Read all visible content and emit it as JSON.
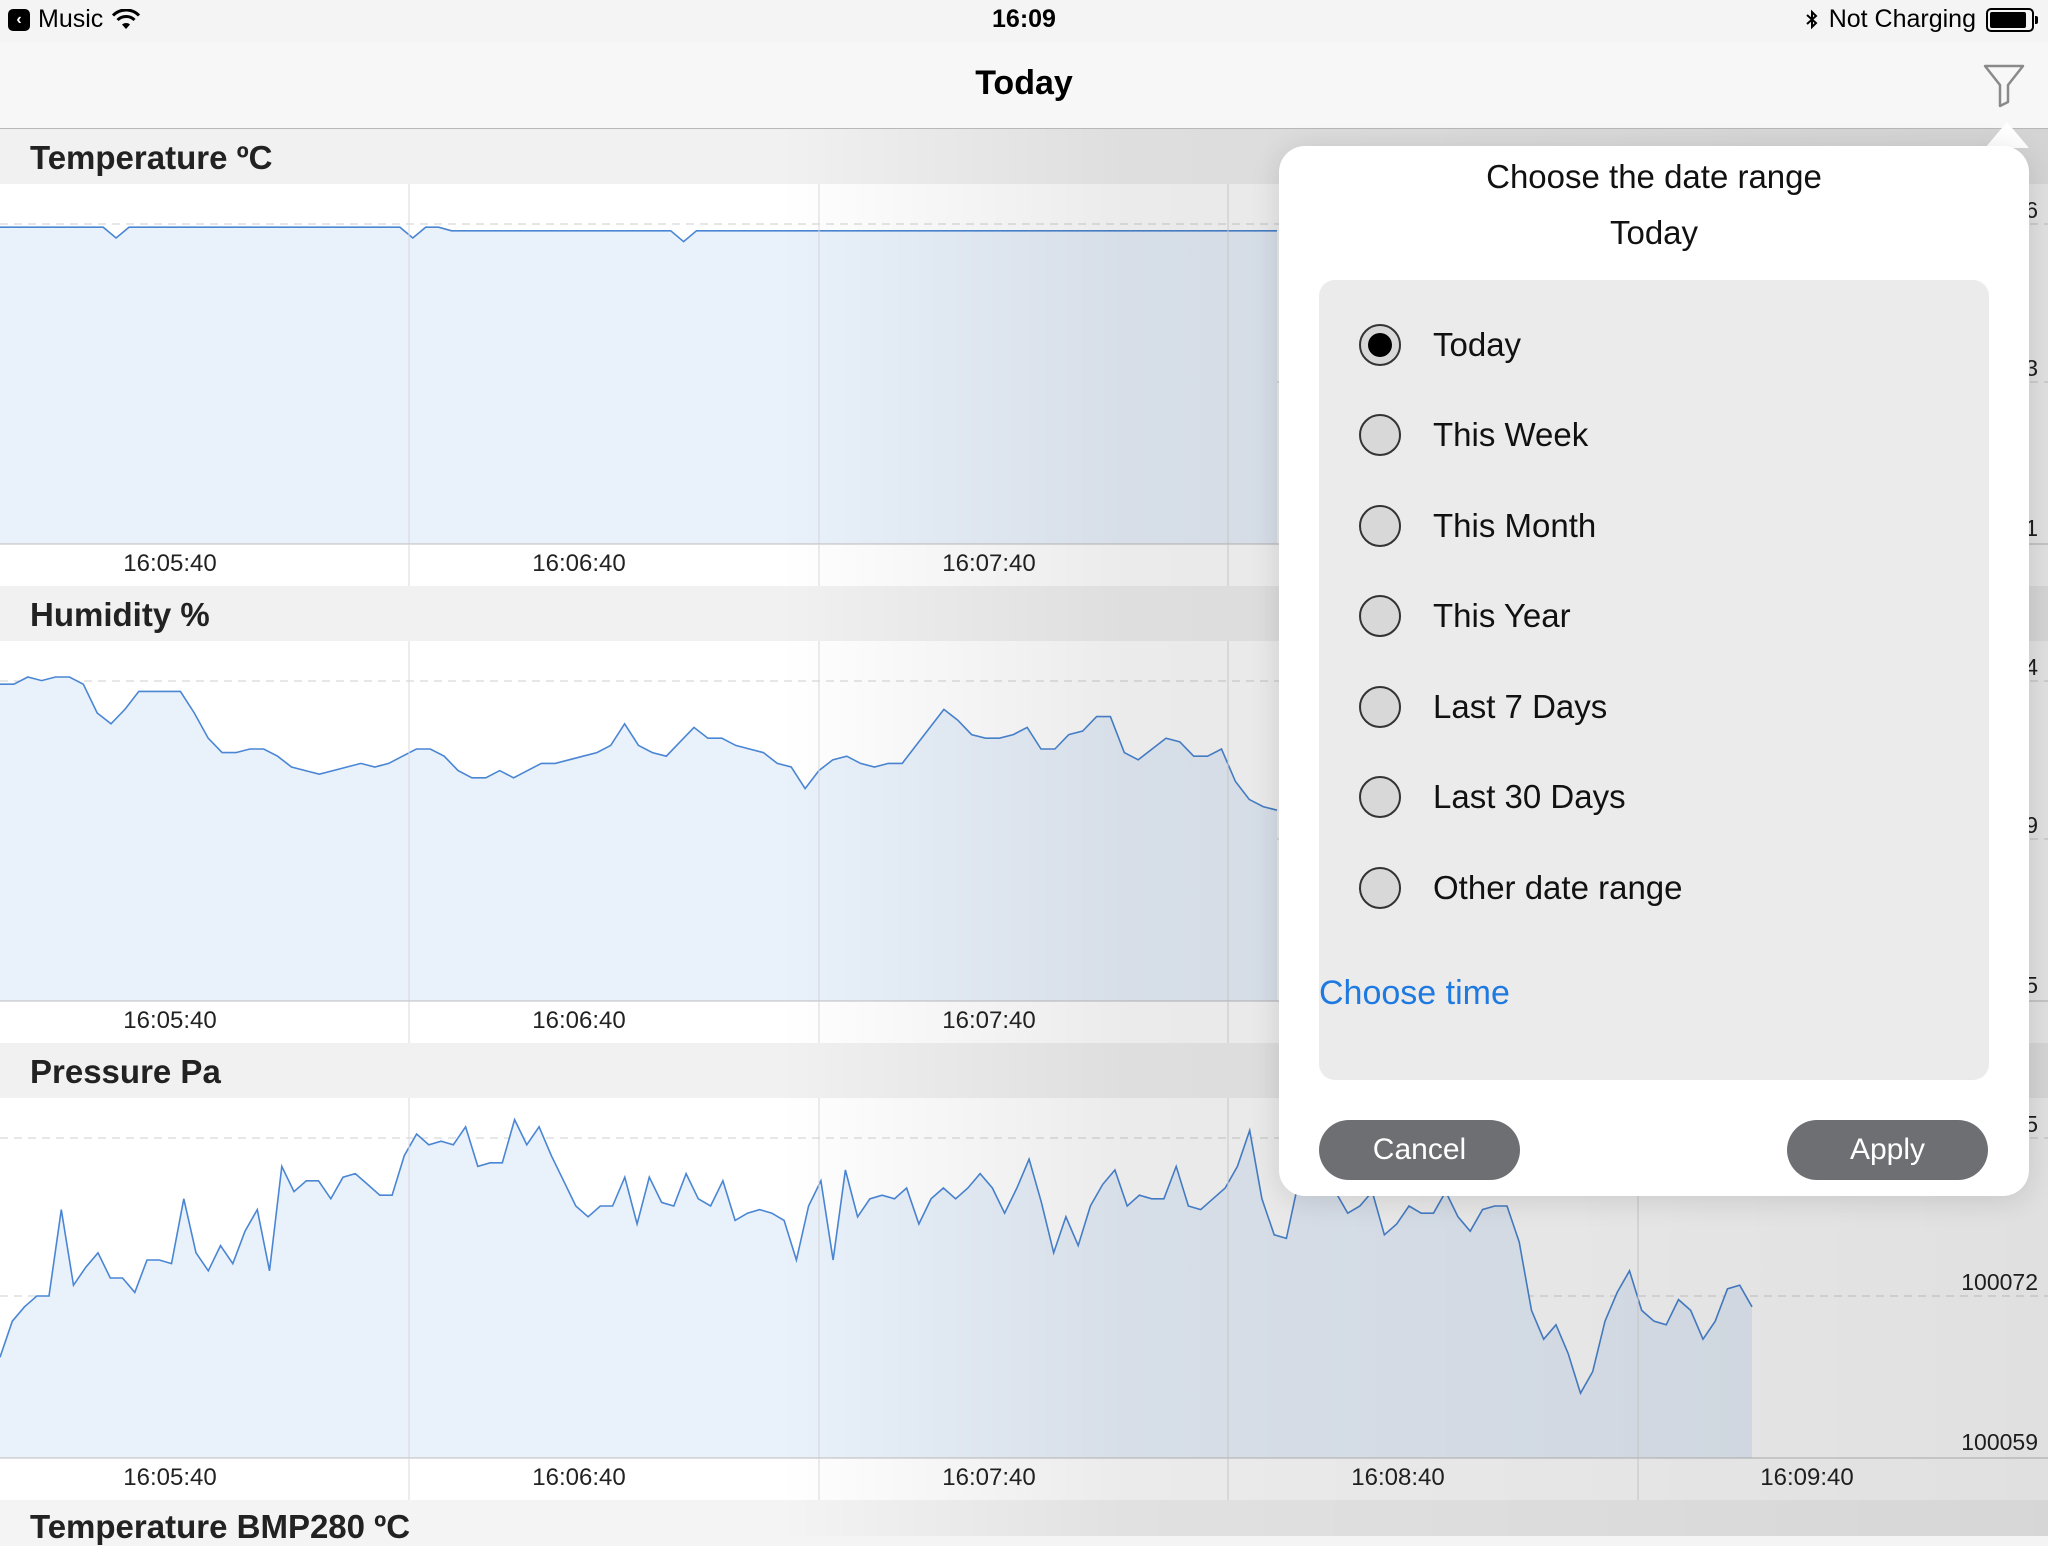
{
  "status_bar": {
    "back_app": "Music",
    "time": "16:09",
    "charging": "Not Charging"
  },
  "nav": {
    "title": "Today",
    "filter_icon": "filter-icon"
  },
  "charts": [
    {
      "title": "Temperature ºC",
      "x_ticks": [
        "16:05:40",
        "16:06:40",
        "16:07:40"
      ],
      "y_labels_partial": [
        "6",
        "3",
        "1"
      ],
      "line_color": "#4a86d4",
      "fill_color": "#e9f1fb"
    },
    {
      "title": "Humidity %",
      "x_ticks": [
        "16:05:40",
        "16:06:40",
        "16:07:40"
      ],
      "y_labels_partial": [
        "4",
        "9",
        "5"
      ]
    },
    {
      "title": "Pressure Pa",
      "x_ticks": [
        "16:05:40",
        "16:06:40",
        "16:07:40",
        "16:08:40",
        "16:09:40"
      ],
      "y_labels": [
        "5",
        "100072",
        "100059"
      ]
    },
    {
      "title": "Temperature BMP280 ºC"
    }
  ],
  "chart_data": [
    {
      "type": "area",
      "title": "Temperature ºC",
      "x": [
        "16:05:40",
        "16:06:40",
        "16:07:40"
      ],
      "series": [
        {
          "values": [
            0.88,
            0.88,
            0.88,
            0.88,
            0.88,
            0.88,
            0.88,
            0.88,
            0.88,
            0.85,
            0.88,
            0.88,
            0.88,
            0.88,
            0.88,
            0.88,
            0.88,
            0.88,
            0.88,
            0.88,
            0.88,
            0.88,
            0.88,
            0.88,
            0.88,
            0.88,
            0.88,
            0.88,
            0.88,
            0.88,
            0.88,
            0.88,
            0.85,
            0.88,
            0.88,
            0.87,
            0.87,
            0.87,
            0.87,
            0.87,
            0.87,
            0.87,
            0.87,
            0.87,
            0.87,
            0.87,
            0.87,
            0.87,
            0.87,
            0.87,
            0.87,
            0.87,
            0.87,
            0.84,
            0.87,
            0.87,
            0.87,
            0.87,
            0.87,
            0.87,
            0.87,
            0.87,
            0.87,
            0.87,
            0.87,
            0.87,
            0.87,
            0.87,
            0.87,
            0.87,
            0.87,
            0.87,
            0.87,
            0.87,
            0.87,
            0.87,
            0.87,
            0.87,
            0.87,
            0.87,
            0.87,
            0.87,
            0.87,
            0.87,
            0.87,
            0.87,
            0.87,
            0.87,
            0.87,
            0.87,
            0.87,
            0.87,
            0.87,
            0.87,
            0.87,
            0.87,
            0.87,
            0.87,
            0.87,
            0.87
          ]
        }
      ]
    },
    {
      "type": "area",
      "title": "Humidity %",
      "x": [
        "16:05:40",
        "16:06:40",
        "16:07:40"
      ],
      "series": [
        {
          "values": [
            0.88,
            0.88,
            0.9,
            0.89,
            0.9,
            0.9,
            0.88,
            0.8,
            0.77,
            0.81,
            0.86,
            0.86,
            0.86,
            0.86,
            0.8,
            0.73,
            0.69,
            0.69,
            0.7,
            0.7,
            0.68,
            0.65,
            0.64,
            0.63,
            0.64,
            0.65,
            0.66,
            0.65,
            0.66,
            0.68,
            0.7,
            0.7,
            0.68,
            0.64,
            0.62,
            0.62,
            0.64,
            0.62,
            0.64,
            0.66,
            0.66,
            0.67,
            0.68,
            0.69,
            0.71,
            0.77,
            0.71,
            0.69,
            0.68,
            0.72,
            0.76,
            0.73,
            0.73,
            0.71,
            0.7,
            0.69,
            0.66,
            0.65,
            0.59,
            0.64,
            0.67,
            0.68,
            0.66,
            0.65,
            0.66,
            0.66,
            0.71,
            0.76,
            0.81,
            0.78,
            0.74,
            0.73,
            0.73,
            0.74,
            0.76,
            0.7,
            0.7,
            0.74,
            0.75,
            0.79,
            0.79,
            0.69,
            0.67,
            0.7,
            0.73,
            0.72,
            0.68,
            0.68,
            0.7,
            0.61,
            0.56,
            0.54,
            0.53
          ]
        }
      ]
    },
    {
      "type": "area",
      "title": "Pressure Pa",
      "x": [
        "16:05:40",
        "16:06:40",
        "16:07:40",
        "16:08:40",
        "16:09:40"
      ],
      "y_labels": [
        "100059",
        "100072"
      ],
      "series": [
        {
          "values": [
            0.28,
            0.38,
            0.42,
            0.45,
            0.45,
            0.69,
            0.48,
            0.53,
            0.57,
            0.5,
            0.5,
            0.46,
            0.55,
            0.55,
            0.54,
            0.72,
            0.57,
            0.52,
            0.59,
            0.54,
            0.63,
            0.69,
            0.52,
            0.81,
            0.74,
            0.77,
            0.77,
            0.72,
            0.78,
            0.79,
            0.76,
            0.73,
            0.73,
            0.84,
            0.9,
            0.87,
            0.88,
            0.87,
            0.92,
            0.81,
            0.82,
            0.82,
            0.94,
            0.87,
            0.92,
            0.84,
            0.77,
            0.7,
            0.67,
            0.7,
            0.7,
            0.78,
            0.65,
            0.78,
            0.71,
            0.7,
            0.79,
            0.72,
            0.7,
            0.77,
            0.66,
            0.68,
            0.69,
            0.68,
            0.66,
            0.55,
            0.7,
            0.77,
            0.55,
            0.8,
            0.67,
            0.72,
            0.73,
            0.72,
            0.75,
            0.65,
            0.72,
            0.75,
            0.72,
            0.75,
            0.79,
            0.75,
            0.68,
            0.75,
            0.83,
            0.71,
            0.57,
            0.67,
            0.59,
            0.7,
            0.76,
            0.8,
            0.7,
            0.73,
            0.72,
            0.72,
            0.81,
            0.7,
            0.69,
            0.72,
            0.75,
            0.81,
            0.91,
            0.72,
            0.62,
            0.61,
            0.77,
            0.74,
            0.75,
            0.74,
            0.68,
            0.7,
            0.74,
            0.62,
            0.65,
            0.7,
            0.68,
            0.68,
            0.74,
            0.67,
            0.63,
            0.69,
            0.7,
            0.7,
            0.6,
            0.41,
            0.33,
            0.37,
            0.29,
            0.18,
            0.24,
            0.38,
            0.46,
            0.52,
            0.41,
            0.38,
            0.37,
            0.44,
            0.41,
            0.33,
            0.38,
            0.47,
            0.48,
            0.42
          ]
        }
      ]
    }
  ],
  "popover": {
    "title": "Choose the date range",
    "subtitle": "Today",
    "options": [
      {
        "label": "Today",
        "selected": true
      },
      {
        "label": "This Week",
        "selected": false
      },
      {
        "label": "This Month",
        "selected": false
      },
      {
        "label": "This Year",
        "selected": false
      },
      {
        "label": "Last 7 Days",
        "selected": false
      },
      {
        "label": "Last 30 Days",
        "selected": false
      },
      {
        "label": "Other date range",
        "selected": false
      }
    ],
    "choose_time": "Choose time",
    "cancel": "Cancel",
    "apply": "Apply",
    "link_color": "#1e7ae0"
  }
}
